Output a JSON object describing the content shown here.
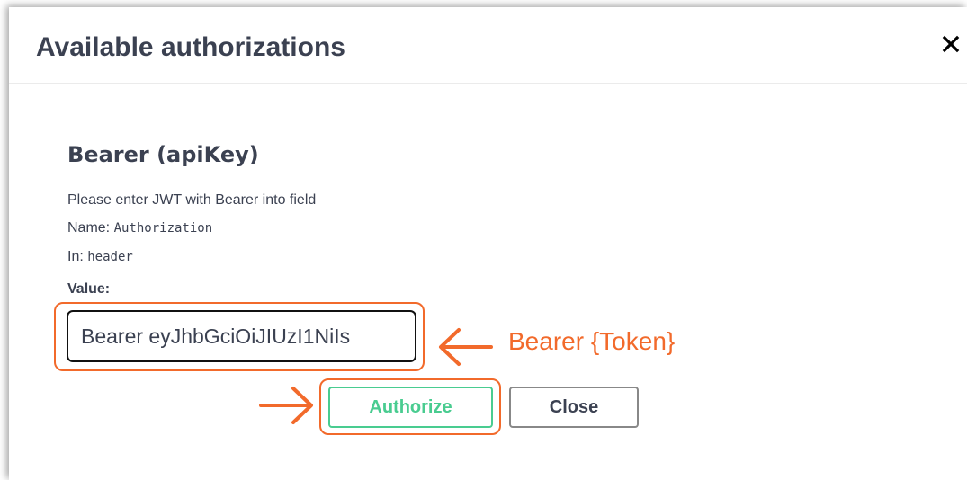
{
  "dialog": {
    "title": "Available authorizations",
    "close_icon": "close-x-icon"
  },
  "scheme": {
    "title": "Bearer (apiKey)",
    "description": "Please enter JWT with Bearer into field",
    "name_label": "Name: ",
    "name_value": "Authorization",
    "in_label": "In: ",
    "in_value": "header",
    "value_label": "Value:",
    "value_input": "Bearer eyJhbGciOiJIUzI1NiIs"
  },
  "buttons": {
    "authorize_label": "Authorize",
    "close_label": "Close"
  },
  "annotations": {
    "token_hint": "Bearer {Token}",
    "accent_color": "#f26a2b",
    "arrow_icons": [
      "arrow-left-icon",
      "arrow-right-icon"
    ]
  },
  "colors": {
    "text": "#3b4151",
    "authorize_green": "#49cc90",
    "close_border": "#888888"
  }
}
